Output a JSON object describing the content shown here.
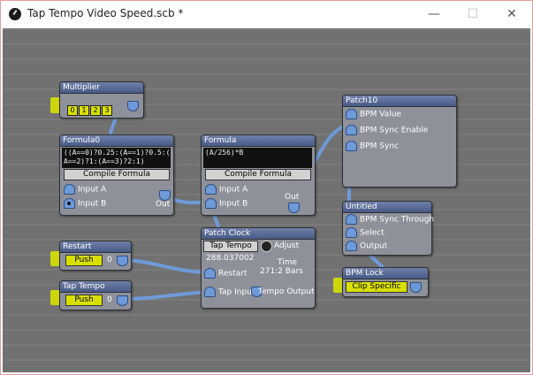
{
  "window": {
    "title": "Tap Tempo Video Speed.scb *",
    "minimize": "—",
    "maximize": "☐",
    "close": "✕"
  },
  "nodes": {
    "multiplier": {
      "title": "Multiplier",
      "options": [
        "0",
        "1",
        "2",
        "3"
      ]
    },
    "formula0": {
      "title": "Formula0",
      "expression": "((A==0)?0.25:(A==1)?0.5:(\nA==2)?1:(A==3)?2:1)",
      "compile": "Compile Formula",
      "input_a": "Input A",
      "input_b": "Input B",
      "out": "Out"
    },
    "formula": {
      "title": "Formula",
      "expression": "(A/256)*B",
      "compile": "Compile Formula",
      "input_a": "Input A",
      "input_b": "Input B",
      "out": "Out"
    },
    "patch_clock": {
      "title": "Patch Clock",
      "tap_tempo": "Tap Tempo",
      "adjust": "Adjust",
      "bpm": "288.037002",
      "time_label": "Time",
      "time_value": "271:2 Bars",
      "restart": "Restart",
      "tap_input": "Tap Input",
      "tempo_output": "Tempo Output"
    },
    "restart": {
      "title": "Restart",
      "button": "Push",
      "value": "0"
    },
    "tap_tempo": {
      "title": "Tap Tempo",
      "button": "Push",
      "value": "0"
    },
    "patch10": {
      "title": "Patch10",
      "ports": [
        "BPM Value",
        "BPM Sync Enable",
        "BPM Sync"
      ]
    },
    "untitled": {
      "title": "Untitled",
      "ports": [
        "BPM Sync Through",
        "Select",
        "Output"
      ]
    },
    "bpm_lock": {
      "title": "BPM Lock",
      "value": "Clip Specific"
    }
  }
}
